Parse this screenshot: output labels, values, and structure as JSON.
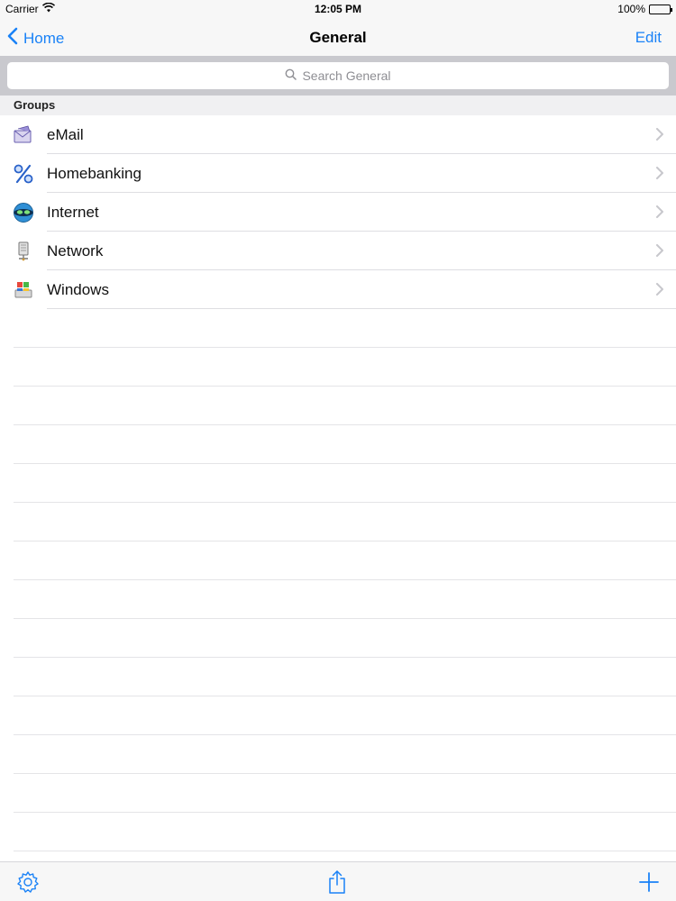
{
  "status_bar": {
    "carrier": "Carrier",
    "time": "12:05 PM",
    "battery": "100%"
  },
  "nav": {
    "back_label": "Home",
    "title": "General",
    "edit_label": "Edit"
  },
  "search": {
    "placeholder": "Search General"
  },
  "section": {
    "title": "Groups"
  },
  "groups": [
    {
      "label": "eMail",
      "icon": "email-icon"
    },
    {
      "label": "Homebanking",
      "icon": "percent-icon"
    },
    {
      "label": "Internet",
      "icon": "globe-icon"
    },
    {
      "label": "Network",
      "icon": "network-icon"
    },
    {
      "label": "Windows",
      "icon": "windows-icon"
    }
  ],
  "toolbar": {
    "left_icon": "gear-icon",
    "center_icon": "share-icon",
    "right_icon": "plus-icon"
  },
  "colors": {
    "accent": "#1a82f7",
    "separator": "#dedee2",
    "search_bg": "#c9c9ce"
  }
}
